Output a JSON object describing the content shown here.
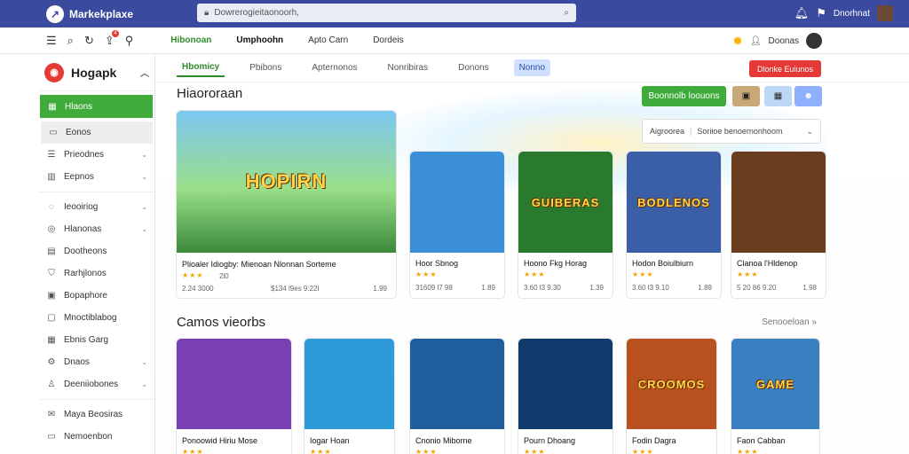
{
  "topbar": {
    "brand": "Markekplaxe",
    "search_placeholder": "Dowrerogieitaonoorh,",
    "user_name": "Dnorhnat"
  },
  "toolbar": {
    "badge_count": "4",
    "tabs": [
      "Hibonoan",
      "Umphoohn",
      "Apto Carn",
      "Dordeis"
    ],
    "user_label": "Doonas"
  },
  "sidebar": {
    "title": "Hogapk",
    "items": [
      {
        "label": "Hlaons",
        "icon": "grid-icon",
        "active": true
      },
      {
        "label": "Eonos",
        "icon": "folder-icon",
        "gray": true
      },
      {
        "label": "Prieodnes",
        "icon": "list-icon",
        "chevron": true
      },
      {
        "label": "Eepnos",
        "icon": "chart-icon",
        "chevron": true
      },
      {
        "label": "Ieooiriog",
        "icon": "chat-icon",
        "chevron": true,
        "sep": true
      },
      {
        "label": "Hlanonas",
        "icon": "pin-icon",
        "chevron": true
      },
      {
        "label": "Dootheons",
        "icon": "doc-icon"
      },
      {
        "label": "Rarhjlonos",
        "icon": "shield-icon"
      },
      {
        "label": "Bopaphore",
        "icon": "image-icon"
      },
      {
        "label": "Mnoctiblabog",
        "icon": "box-icon"
      },
      {
        "label": "Ebnis Garg",
        "icon": "calendar-icon"
      },
      {
        "label": "Dnaos",
        "icon": "settings-icon",
        "chevron": true
      },
      {
        "label": "Deeniiobones",
        "icon": "users-icon",
        "chevron": true
      },
      {
        "label": "Maya Beosiras",
        "icon": "mail-icon",
        "sep": true
      },
      {
        "label": "Nemoenbon",
        "icon": "card-icon"
      }
    ]
  },
  "subtabs": [
    "Hbomicy",
    "Pbibons",
    "Apternonos",
    "Nonribiras",
    "Donons",
    "Nonno"
  ],
  "subtab_active": 0,
  "subtab_selected": 5,
  "red_button": "Dlonke Euiunos",
  "section1": {
    "title": "Hiaororaan",
    "green_button": "Boonnolb loouons",
    "dropdown_label": "Aigroorea",
    "dropdown_value": "Soriioe benoernonhoom"
  },
  "section2": {
    "title": "Camos vieorbs",
    "see_all": "Senooeloan"
  },
  "featured": {
    "name": "Plioaler Idiogby: Mienoan Nlonnan Sorteme",
    "stars": "★★★",
    "rating": "2l0",
    "meta1": "2.24 3000",
    "meta2": "$134 l9es 9:22l",
    "price": "1.99",
    "thumb_text": "HOPIRN"
  },
  "row1": [
    {
      "name": "Hoor Sbnog",
      "stars": "★★★",
      "meta1": "31609 l7 98",
      "price": "1.89",
      "thumb_text": "",
      "bg": "#3b8fd8"
    },
    {
      "name": "Hoono Fkg Horag",
      "stars": "★★★",
      "meta1": "3.60 l3 9.30",
      "price": "1.39",
      "thumb_text": "GUIBERAS",
      "bg": "#2a7a2e"
    },
    {
      "name": "Hodon Boiulbiurn",
      "stars": "★★★",
      "meta1": "3.60 l3 9.10",
      "price": "1.89",
      "thumb_text": "BODLENOS",
      "bg": "#3b5fa6"
    },
    {
      "name": "Clanoa l'Hldenop",
      "stars": "★★★",
      "meta1": "5 20 86 9.20",
      "price": "1.98",
      "thumb_text": "",
      "bg": "#6a3d1f"
    }
  ],
  "row2": [
    {
      "name": "Ponoowid Hiriu Mose",
      "stars": "★★★",
      "thumb_text": "",
      "bg": "#7a3fb3"
    },
    {
      "name": "Iogar Hoan",
      "stars": "★★★",
      "thumb_text": "",
      "bg": "#2e9ad8"
    },
    {
      "name": "Cnonio Miborne",
      "stars": "★★★",
      "thumb_text": "",
      "bg": "#1f5f9e"
    },
    {
      "name": "Pourn Dhoang",
      "stars": "★★★",
      "thumb_text": "",
      "bg": "#103a6b"
    },
    {
      "name": "Fodin Dagra",
      "stars": "★★★",
      "thumb_text": "CROOMOS",
      "bg": "#b8511f"
    },
    {
      "name": "Faon Cabban",
      "stars": "★★★",
      "thumb_text": "GAME",
      "bg": "#3a7fc0"
    }
  ]
}
